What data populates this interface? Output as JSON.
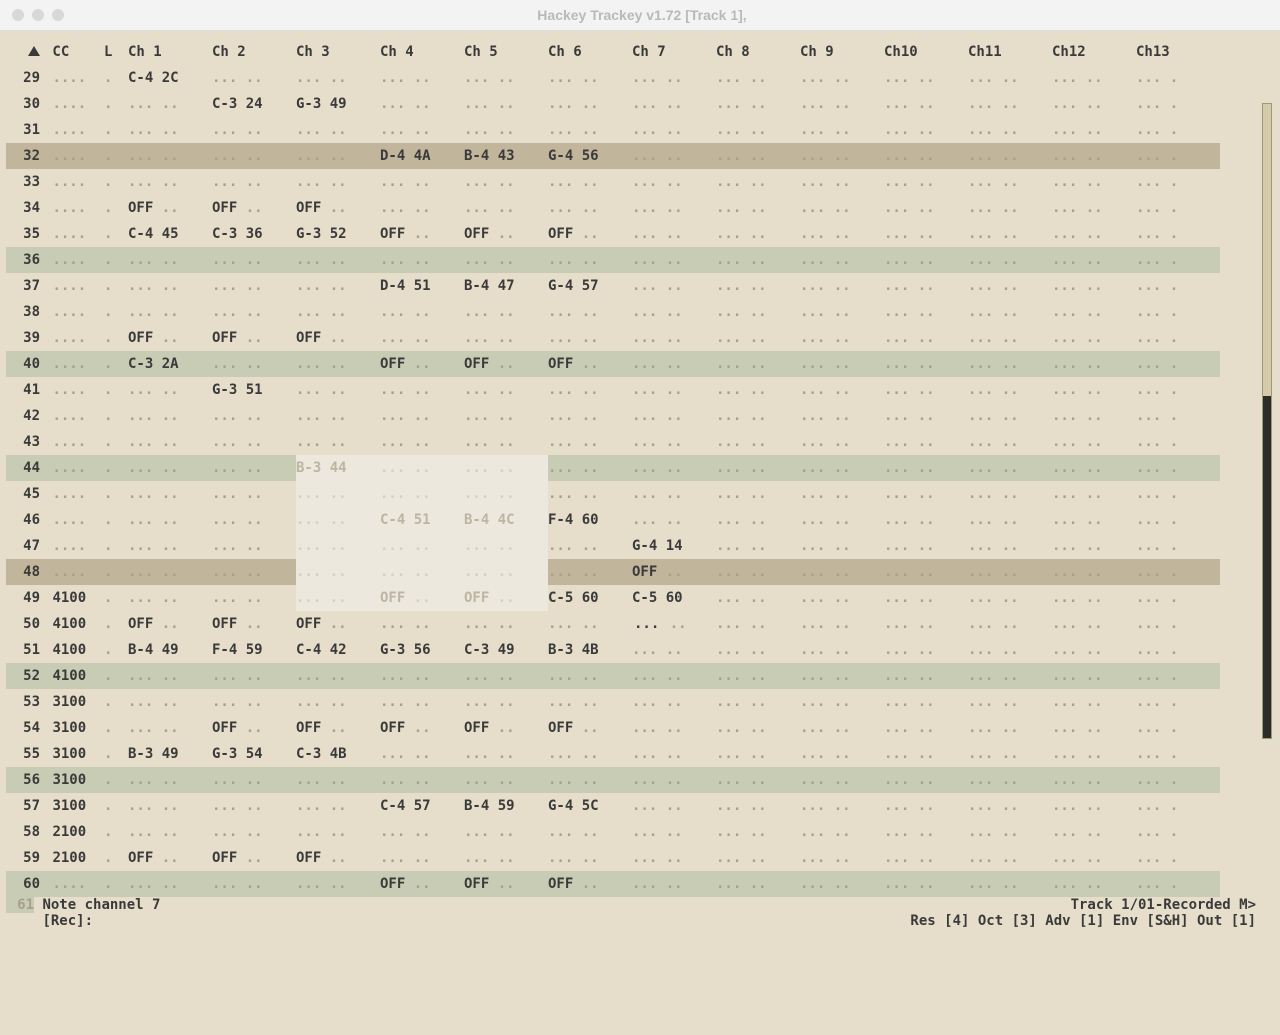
{
  "title": "Hackey Trackey v1.72 [Track 1],",
  "columns": [
    "",
    "CC",
    "L",
    "Ch 1",
    "Ch 2",
    "Ch 3",
    "Ch 4",
    "Ch 5",
    "Ch 6",
    "Ch 7",
    "Ch 8",
    "Ch 9",
    "Ch10",
    "Ch11",
    "Ch12",
    "Ch13"
  ],
  "rows": [
    {
      "n": 29,
      "cc": "....",
      "l": ".",
      "c": [
        "C-4 2C",
        "... ..",
        "... ..",
        "... ..",
        "... ..",
        "... ..",
        "... ..",
        "... ..",
        "... ..",
        "... ..",
        "... ..",
        "... ..",
        "... ."
      ]
    },
    {
      "n": 30,
      "cc": "....",
      "l": ".",
      "c": [
        "... ..",
        "C-3 24",
        "G-3 49",
        "... ..",
        "... ..",
        "... ..",
        "... ..",
        "... ..",
        "... ..",
        "... ..",
        "... ..",
        "... ..",
        "... ."
      ]
    },
    {
      "n": 31,
      "cc": "....",
      "l": ".",
      "c": [
        "... ..",
        "... ..",
        "... ..",
        "... ..",
        "... ..",
        "... ..",
        "... ..",
        "... ..",
        "... ..",
        "... ..",
        "... ..",
        "... ..",
        "... ."
      ]
    },
    {
      "n": 32,
      "cc": "....",
      "l": ".",
      "hl": "brown",
      "c": [
        "... ..",
        "... ..",
        "... ..",
        "D-4 4A",
        "B-4 43",
        "G-4 56",
        "... ..",
        "... ..",
        "... ..",
        "... ..",
        "... ..",
        "... ..",
        "... ."
      ]
    },
    {
      "n": 33,
      "cc": "....",
      "l": ".",
      "c": [
        "... ..",
        "... ..",
        "... ..",
        "... ..",
        "... ..",
        "... ..",
        "... ..",
        "... ..",
        "... ..",
        "... ..",
        "... ..",
        "... ..",
        "... ."
      ]
    },
    {
      "n": 34,
      "cc": "....",
      "l": ".",
      "c": [
        "OFF ..",
        "OFF ..",
        "OFF ..",
        "... ..",
        "... ..",
        "... ..",
        "... ..",
        "... ..",
        "... ..",
        "... ..",
        "... ..",
        "... ..",
        "... ."
      ]
    },
    {
      "n": 35,
      "cc": "....",
      "l": ".",
      "c": [
        "C-4 45",
        "C-3 36",
        "G-3 52",
        "OFF ..",
        "OFF ..",
        "OFF ..",
        "... ..",
        "... ..",
        "... ..",
        "... ..",
        "... ..",
        "... ..",
        "... ."
      ]
    },
    {
      "n": 36,
      "cc": "....",
      "l": ".",
      "hl": "green",
      "c": [
        "... ..",
        "... ..",
        "... ..",
        "... ..",
        "... ..",
        "... ..",
        "... ..",
        "... ..",
        "... ..",
        "... ..",
        "... ..",
        "... ..",
        "... ."
      ]
    },
    {
      "n": 37,
      "cc": "....",
      "l": ".",
      "c": [
        "... ..",
        "... ..",
        "... ..",
        "D-4 51",
        "B-4 47",
        "G-4 57",
        "... ..",
        "... ..",
        "... ..",
        "... ..",
        "... ..",
        "... ..",
        "... ."
      ]
    },
    {
      "n": 38,
      "cc": "....",
      "l": ".",
      "c": [
        "... ..",
        "... ..",
        "... ..",
        "... ..",
        "... ..",
        "... ..",
        "... ..",
        "... ..",
        "... ..",
        "... ..",
        "... ..",
        "... ..",
        "... ."
      ]
    },
    {
      "n": 39,
      "cc": "....",
      "l": ".",
      "c": [
        "OFF ..",
        "OFF ..",
        "OFF ..",
        "... ..",
        "... ..",
        "... ..",
        "... ..",
        "... ..",
        "... ..",
        "... ..",
        "... ..",
        "... ..",
        "... ."
      ]
    },
    {
      "n": 40,
      "cc": "....",
      "l": ".",
      "hl": "green",
      "c": [
        "C-3 2A",
        "... ..",
        "... ..",
        "OFF ..",
        "OFF ..",
        "OFF ..",
        "... ..",
        "... ..",
        "... ..",
        "... ..",
        "... ..",
        "... ..",
        "... ."
      ]
    },
    {
      "n": 41,
      "cc": "....",
      "l": ".",
      "c": [
        "... ..",
        "G-3 51",
        "... ..",
        "... ..",
        "... ..",
        "... ..",
        "... ..",
        "... ..",
        "... ..",
        "... ..",
        "... ..",
        "... ..",
        "... ."
      ]
    },
    {
      "n": 42,
      "cc": "....",
      "l": ".",
      "c": [
        "... ..",
        "... ..",
        "... ..",
        "... ..",
        "... ..",
        "... ..",
        "... ..",
        "... ..",
        "... ..",
        "... ..",
        "... ..",
        "... ..",
        "... ."
      ]
    },
    {
      "n": 43,
      "cc": "....",
      "l": ".",
      "c": [
        "... ..",
        "... ..",
        "... ..",
        "... ..",
        "... ..",
        "... ..",
        "... ..",
        "... ..",
        "... ..",
        "... ..",
        "... ..",
        "... ..",
        "... ."
      ]
    },
    {
      "n": 44,
      "cc": "....",
      "l": ".",
      "hl": "green",
      "sel": [
        2,
        4
      ],
      "c": [
        "... ..",
        "... ..",
        "B-3 44",
        "... ..",
        "... ..",
        "... ..",
        "... ..",
        "... ..",
        "... ..",
        "... ..",
        "... ..",
        "... ..",
        "... ."
      ]
    },
    {
      "n": 45,
      "cc": "....",
      "l": ".",
      "sel": [
        2,
        4
      ],
      "c": [
        "... ..",
        "... ..",
        "... ..",
        "... ..",
        "... ..",
        "... ..",
        "... ..",
        "... ..",
        "... ..",
        "... ..",
        "... ..",
        "... ..",
        "... ."
      ]
    },
    {
      "n": 46,
      "cc": "....",
      "l": ".",
      "sel": [
        2,
        4
      ],
      "c": [
        "... ..",
        "... ..",
        "... ..",
        "C-4 51",
        "B-4 4C",
        "F-4 60",
        "... ..",
        "... ..",
        "... ..",
        "... ..",
        "... ..",
        "... ..",
        "... ."
      ]
    },
    {
      "n": 47,
      "cc": "....",
      "l": ".",
      "sel": [
        2,
        4
      ],
      "c": [
        "... ..",
        "... ..",
        "... ..",
        "... ..",
        "... ..",
        "... ..",
        "G-4 14",
        "... ..",
        "... ..",
        "... ..",
        "... ..",
        "... ..",
        "... ."
      ]
    },
    {
      "n": 48,
      "cc": "....",
      "l": ".",
      "hl": "brown",
      "sel": [
        2,
        4
      ],
      "c": [
        "... ..",
        "... ..",
        "... ..",
        "... ..",
        "... ..",
        "... ..",
        "OFF ..",
        "... ..",
        "... ..",
        "... ..",
        "... ..",
        "... ..",
        "... ."
      ]
    },
    {
      "n": 49,
      "cc": "4100",
      "l": ".",
      "sel": [
        2,
        4
      ],
      "c": [
        "... ..",
        "... ..",
        "... ..",
        "OFF ..",
        "OFF ..",
        "C-5 60",
        "C-5 60",
        "... ..",
        "... ..",
        "... ..",
        "... ..",
        "... ..",
        "... ."
      ]
    },
    {
      "n": 50,
      "cc": "4100",
      "l": ".",
      "cursor": 6,
      "c": [
        "OFF ..",
        "OFF ..",
        "OFF ..",
        "... ..",
        "... ..",
        "... ..",
        "... ..",
        "... ..",
        "... ..",
        "... ..",
        "... ..",
        "... ..",
        "... ."
      ]
    },
    {
      "n": 51,
      "cc": "4100",
      "l": ".",
      "c": [
        "B-4 49",
        "F-4 59",
        "C-4 42",
        "G-3 56",
        "C-3 49",
        "B-3 4B",
        "... ..",
        "... ..",
        "... ..",
        "... ..",
        "... ..",
        "... ..",
        "... ."
      ]
    },
    {
      "n": 52,
      "cc": "4100",
      "l": ".",
      "hl": "green",
      "c": [
        "... ..",
        "... ..",
        "... ..",
        "... ..",
        "... ..",
        "... ..",
        "... ..",
        "... ..",
        "... ..",
        "... ..",
        "... ..",
        "... ..",
        "... ."
      ]
    },
    {
      "n": 53,
      "cc": "3100",
      "l": ".",
      "c": [
        "... ..",
        "... ..",
        "... ..",
        "... ..",
        "... ..",
        "... ..",
        "... ..",
        "... ..",
        "... ..",
        "... ..",
        "... ..",
        "... ..",
        "... ."
      ]
    },
    {
      "n": 54,
      "cc": "3100",
      "l": ".",
      "c": [
        "... ..",
        "OFF ..",
        "OFF ..",
        "OFF ..",
        "OFF ..",
        "OFF ..",
        "... ..",
        "... ..",
        "... ..",
        "... ..",
        "... ..",
        "... ..",
        "... ."
      ]
    },
    {
      "n": 55,
      "cc": "3100",
      "l": ".",
      "c": [
        "B-3 49",
        "G-3 54",
        "C-3 4B",
        "... ..",
        "... ..",
        "... ..",
        "... ..",
        "... ..",
        "... ..",
        "... ..",
        "... ..",
        "... ..",
        "... ."
      ]
    },
    {
      "n": 56,
      "cc": "3100",
      "l": ".",
      "hl": "green",
      "c": [
        "... ..",
        "... ..",
        "... ..",
        "... ..",
        "... ..",
        "... ..",
        "... ..",
        "... ..",
        "... ..",
        "... ..",
        "... ..",
        "... ..",
        "... ."
      ]
    },
    {
      "n": 57,
      "cc": "3100",
      "l": ".",
      "c": [
        "... ..",
        "... ..",
        "... ..",
        "C-4 57",
        "B-4 59",
        "G-4 5C",
        "... ..",
        "... ..",
        "... ..",
        "... ..",
        "... ..",
        "... ..",
        "... ."
      ]
    },
    {
      "n": 58,
      "cc": "2100",
      "l": ".",
      "c": [
        "... ..",
        "... ..",
        "... ..",
        "... ..",
        "... ..",
        "... ..",
        "... ..",
        "... ..",
        "... ..",
        "... ..",
        "... ..",
        "... ..",
        "... ."
      ]
    },
    {
      "n": 59,
      "cc": "2100",
      "l": ".",
      "c": [
        "OFF ..",
        "OFF ..",
        "OFF ..",
        "... ..",
        "... ..",
        "... ..",
        "... ..",
        "... ..",
        "... ..",
        "... ..",
        "... ..",
        "... ..",
        "... ."
      ]
    },
    {
      "n": 60,
      "cc": "....",
      "l": ".",
      "hl": "green",
      "c": [
        "... ..",
        "... ..",
        "... ..",
        "OFF ..",
        "OFF ..",
        "OFF ..",
        "... ..",
        "... ..",
        "... ..",
        "... ..",
        "... ..",
        "... ..",
        "... ."
      ]
    }
  ],
  "bottom_index": "61",
  "status_left1": "Note channel  7",
  "status_left2": "[Rec]:",
  "status_right1": "Track 1/01-Recorded M>",
  "status_right2": "Res [4] Oct [3] Adv [1] Env [S&H] Out [1]"
}
